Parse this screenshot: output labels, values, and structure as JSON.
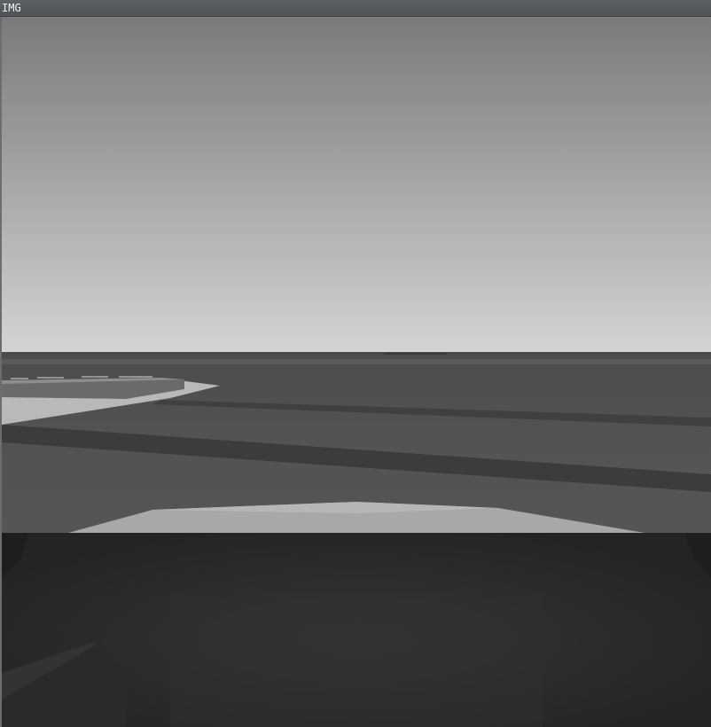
{
  "window": {
    "title": "IMG"
  },
  "scene": {
    "description_type": "driving-simulator-camera-view",
    "colors": {
      "sky_top": "#7a7a7a",
      "sky_horizon": "#d2d2d2",
      "ground": "#555555",
      "road_dark_band": "#3f3f3f",
      "sidewalk": "#b8b8b8",
      "hood_highlight": "#a9a9a9",
      "dashboard": "#2c2c2c"
    }
  }
}
